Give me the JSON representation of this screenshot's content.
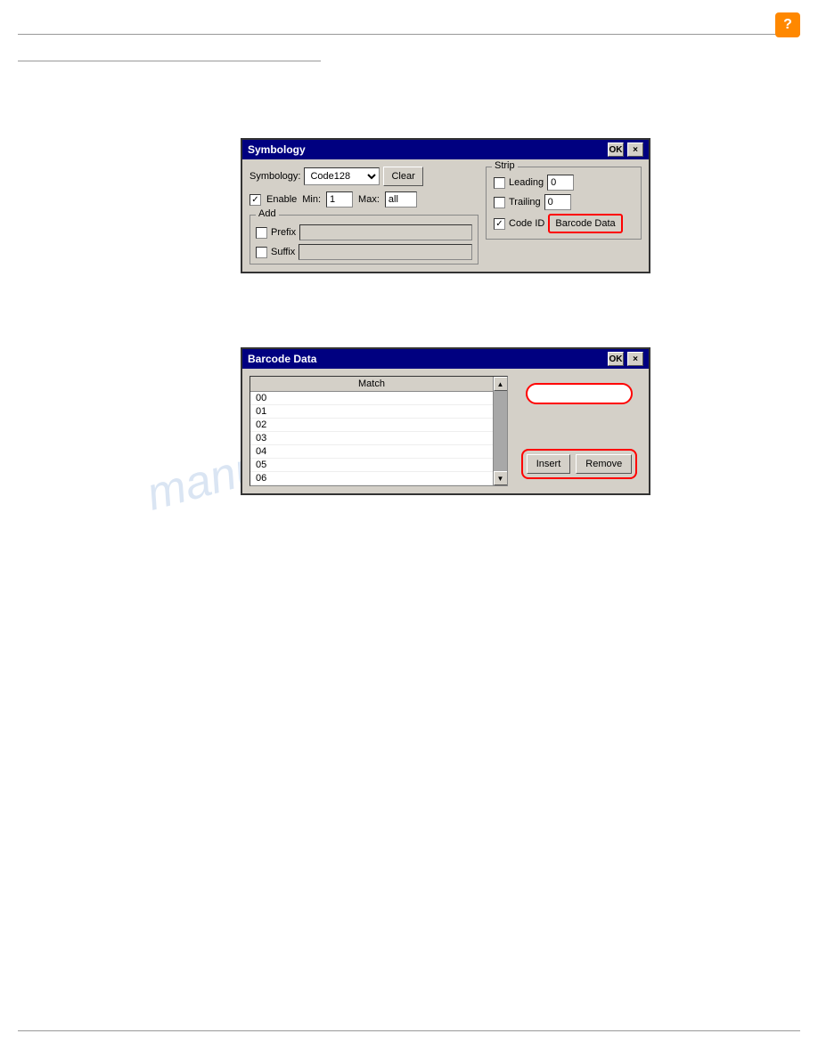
{
  "page": {
    "help_icon": "?",
    "watermark": "manualslib.com"
  },
  "symbology_dialog": {
    "title": "Symbology",
    "ok_label": "OK",
    "close_label": "×",
    "symbology_label": "Symbology:",
    "symbology_value": "Code128",
    "clear_label": "Clear",
    "enable_label": "Enable",
    "enable_checked": true,
    "min_label": "Min:",
    "min_value": "1",
    "max_label": "Max:",
    "max_value": "all",
    "add_legend": "Add",
    "prefix_label": "Prefix",
    "prefix_value": "",
    "suffix_label": "Suffix",
    "suffix_value": "",
    "strip_legend": "Strip",
    "leading_label": "Leading",
    "leading_checked": false,
    "leading_value": "0",
    "trailing_label": "Trailing",
    "trailing_checked": false,
    "trailing_value": "0",
    "code_id_label": "Code ID",
    "code_id_checked": true,
    "barcode_data_btn_label": "Barcode Data"
  },
  "barcode_dialog": {
    "title": "Barcode Data",
    "ok_label": "OK",
    "close_label": "×",
    "column_match": "Match",
    "rows": [
      "00",
      "01",
      "02",
      "03",
      "04",
      "05",
      "06"
    ],
    "text_input_value": "",
    "insert_label": "Insert",
    "remove_label": "Remove"
  }
}
